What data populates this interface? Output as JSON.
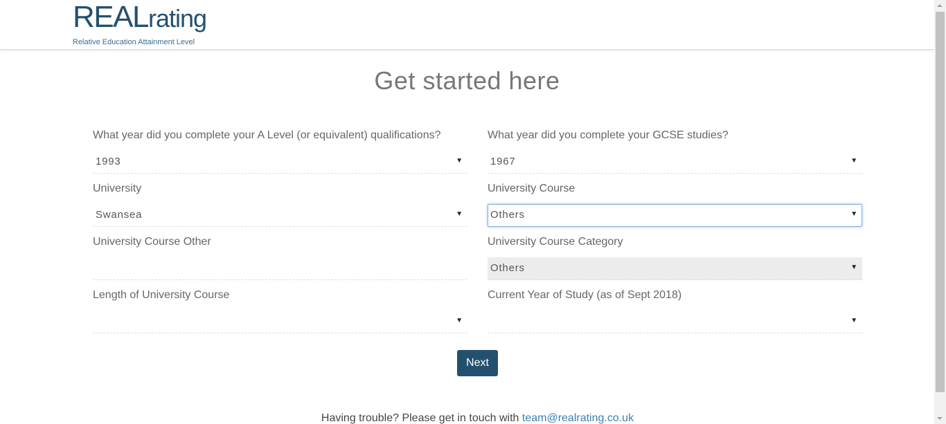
{
  "header": {
    "logo_main_real": "REAL",
    "logo_main_rating": "rating",
    "logo_tagline": "Relative Education Attainment Level"
  },
  "page_title": "Get started here",
  "form": {
    "a_level_year": {
      "label": "What year did you complete your A Level (or equivalent) qualifications?",
      "value": "1993"
    },
    "gcse_year": {
      "label": "What year did you complete your GCSE studies?",
      "value": "1967"
    },
    "university": {
      "label": "University",
      "value": "Swansea"
    },
    "university_course": {
      "label": "University Course",
      "value": "Others"
    },
    "university_course_other": {
      "label": "University Course Other",
      "value": ""
    },
    "university_course_category": {
      "label": "University Course Category",
      "value": "Others"
    },
    "course_length": {
      "label": "Length of University Course",
      "value": ""
    },
    "current_year": {
      "label": "Current Year of Study (as of Sept 2018)",
      "value": ""
    }
  },
  "next_label": "Next",
  "footer": {
    "help_text": "Having trouble? Please get in touch with ",
    "help_email": "team@realrating.co.uk"
  },
  "colors": {
    "brand": "#24506f",
    "link": "#3a7fb2",
    "focus": "#7aaeda"
  }
}
